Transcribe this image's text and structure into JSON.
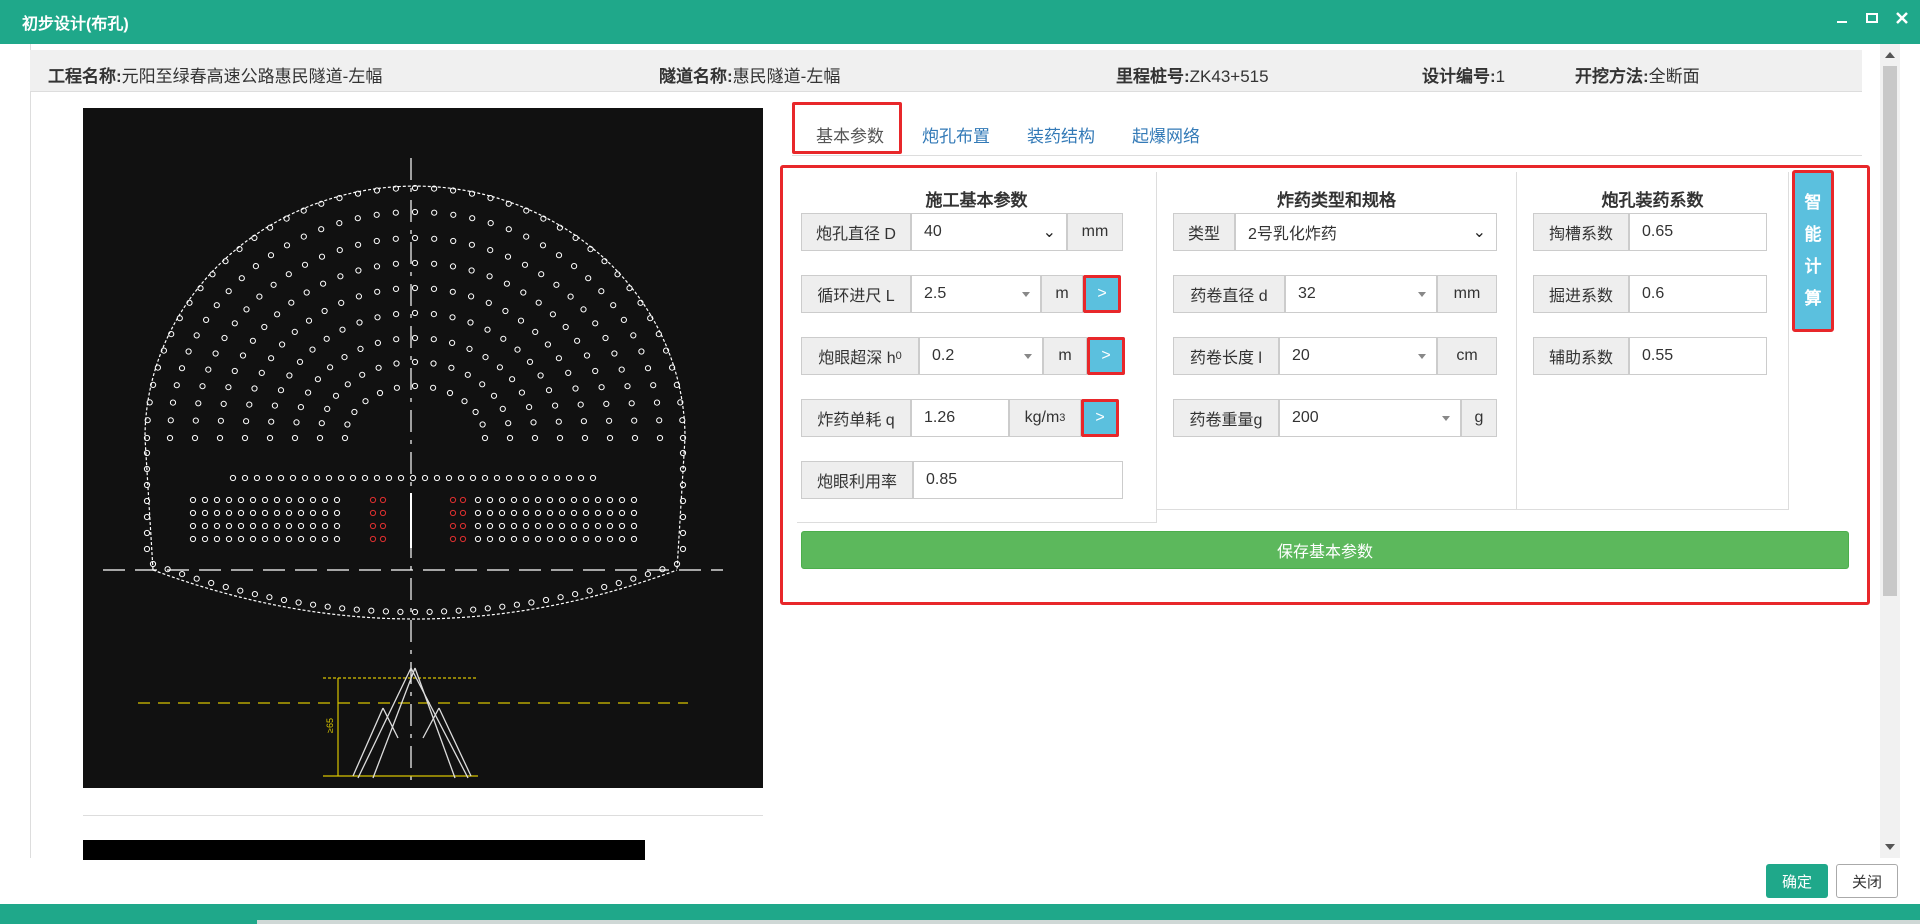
{
  "window": {
    "title": "初步设计(布孔)"
  },
  "info": {
    "project_label": "工程名称:",
    "project_value": "元阳至绿春高速公路惠民隧道-左幅",
    "tunnel_label": "隧道名称:",
    "tunnel_value": "惠民隧道-左幅",
    "station_label": "里程桩号:",
    "station_value": "ZK43+515",
    "design_label": "设计编号:",
    "design_value": "1",
    "method_label": "开挖方法:",
    "method_value": "全断面"
  },
  "tabs": [
    "基本参数",
    "炮孔布置",
    "装药结构",
    "起爆网络"
  ],
  "groups": {
    "construction": {
      "title": "施工基本参数",
      "diameter": {
        "label": "炮孔直径 D",
        "value": "40",
        "unit": "mm"
      },
      "advance": {
        "label": "循环进尺 L",
        "value": "2.5",
        "unit": "m"
      },
      "overdepth": {
        "label": "炮眼超深 h",
        "sub": "0",
        "value": "0.2",
        "unit": "m"
      },
      "consumption": {
        "label": "炸药单耗 q",
        "value": "1.26",
        "unit": "kg/m",
        "sup": "3"
      },
      "utilization": {
        "label": "炮眼利用率",
        "value": "0.85"
      },
      "go_label": ">"
    },
    "explosive": {
      "title": "炸药类型和规格",
      "type": {
        "label": "类型",
        "value": "2号乳化炸药"
      },
      "roll_diameter": {
        "label": "药卷直径 d",
        "value": "32",
        "unit": "mm"
      },
      "roll_length": {
        "label": "药卷长度 l",
        "value": "20",
        "unit": "cm"
      },
      "roll_weight": {
        "label": "药卷重量g",
        "value": "200",
        "unit": "g"
      }
    },
    "charge": {
      "title": "炮孔装药系数",
      "cut": {
        "label": "掏槽系数",
        "value": "0.65"
      },
      "advance": {
        "label": "掘进系数",
        "value": "0.6"
      },
      "auxiliary": {
        "label": "辅助系数",
        "value": "0.55"
      }
    }
  },
  "save_label": "保存基本参数",
  "smart_calc": [
    "智",
    "能",
    "计",
    "算"
  ],
  "footer": {
    "ok": "确定",
    "close": "关闭"
  },
  "drawing": {
    "dim_text": "≥65"
  }
}
